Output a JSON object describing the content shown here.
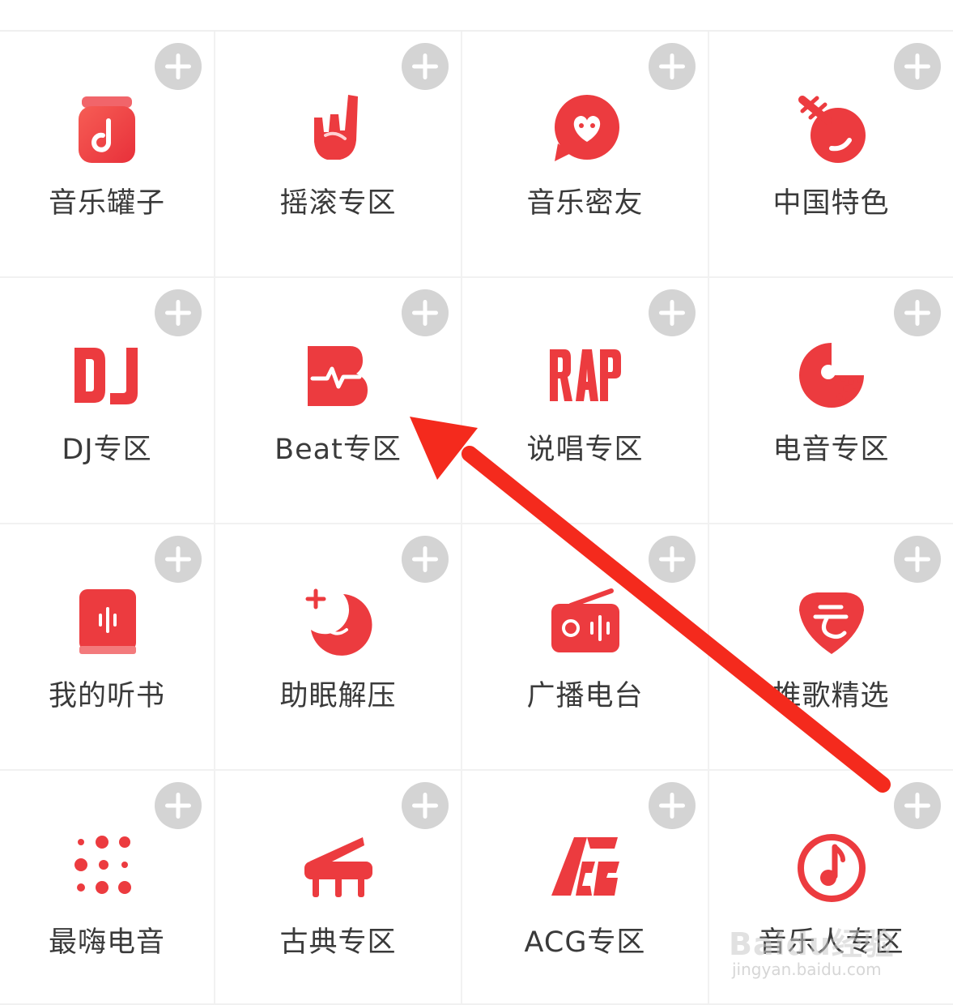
{
  "colors": {
    "accent": "#ec3b3f",
    "add_button": "#d4d4d4",
    "label": "#3a3a3a",
    "annotation_arrow": "#f42a1d"
  },
  "add_icon": "plus-circle-icon",
  "tiles": [
    {
      "label": "音乐罐子",
      "icon": "music-jar-icon"
    },
    {
      "label": "摇滚专区",
      "icon": "rock-hand-icon"
    },
    {
      "label": "音乐密友",
      "icon": "heart-chat-icon"
    },
    {
      "label": "中国特色",
      "icon": "pipa-icon"
    },
    {
      "label": "DJ专区",
      "icon": "dj-icon"
    },
    {
      "label": "Beat专区",
      "icon": "beat-icon"
    },
    {
      "label": "说唱专区",
      "icon": "rap-icon"
    },
    {
      "label": "电音专区",
      "icon": "electronic-disc-icon"
    },
    {
      "label": "我的听书",
      "icon": "audiobook-icon"
    },
    {
      "label": "助眠解压",
      "icon": "moon-icon"
    },
    {
      "label": "广播电台",
      "icon": "radio-icon"
    },
    {
      "label": "推歌精选",
      "icon": "recommend-pick-icon"
    },
    {
      "label": "最嗨电音",
      "icon": "dot-matrix-icon"
    },
    {
      "label": "古典专区",
      "icon": "piano-icon"
    },
    {
      "label": "ACG专区",
      "icon": "acg-icon"
    },
    {
      "label": "音乐人专区",
      "icon": "musician-note-icon"
    }
  ],
  "watermark": {
    "brand": "Baidu经验",
    "url": "jingyan.baidu.com"
  }
}
